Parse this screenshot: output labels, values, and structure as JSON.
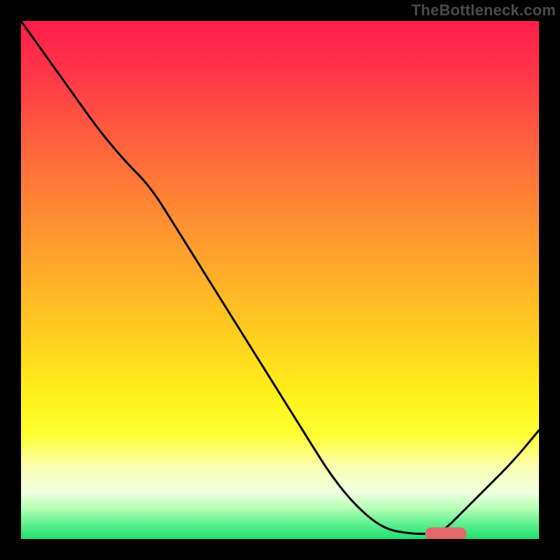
{
  "watermark": "TheBottleneck.com",
  "chart_data": {
    "type": "line",
    "title": "",
    "xlabel": "",
    "ylabel": "",
    "xlim": [
      0,
      100
    ],
    "ylim": [
      0,
      100
    ],
    "grid": false,
    "legend": false,
    "series": [
      {
        "name": "curve",
        "x": [
          0,
          5,
          10,
          15,
          20,
          25,
          30,
          35,
          40,
          45,
          50,
          55,
          60,
          65,
          70,
          75,
          80,
          82,
          85,
          90,
          95,
          100
        ],
        "values": [
          100,
          93,
          86,
          79,
          73,
          68,
          60,
          52,
          44,
          36,
          28,
          20,
          12,
          6,
          2,
          1,
          1,
          2,
          5,
          10,
          15,
          21
        ]
      }
    ],
    "marker": {
      "x": 78,
      "y": 1,
      "width": 8,
      "height": 2.5
    },
    "gradient_stops": [
      {
        "offset": 0.0,
        "color": "#ff1f4b"
      },
      {
        "offset": 0.08,
        "color": "#ff2f49"
      },
      {
        "offset": 0.2,
        "color": "#ff5740"
      },
      {
        "offset": 0.35,
        "color": "#ff8534"
      },
      {
        "offset": 0.5,
        "color": "#ffb028"
      },
      {
        "offset": 0.62,
        "color": "#ffd21e"
      },
      {
        "offset": 0.72,
        "color": "#fff01a"
      },
      {
        "offset": 0.8,
        "color": "#ffff33"
      },
      {
        "offset": 0.86,
        "color": "#faffb0"
      },
      {
        "offset": 0.91,
        "color": "#f0ffe0"
      },
      {
        "offset": 0.94,
        "color": "#b8ffb8"
      },
      {
        "offset": 0.97,
        "color": "#60f090"
      },
      {
        "offset": 1.0,
        "color": "#20e070"
      }
    ]
  }
}
